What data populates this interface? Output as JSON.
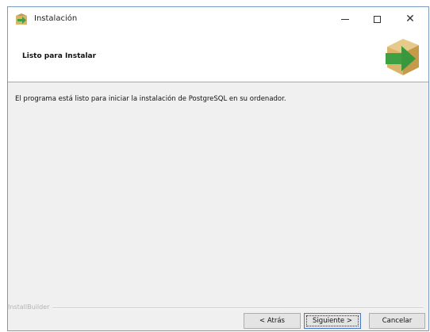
{
  "window": {
    "title": "Instalación",
    "controls": {
      "minimize": "minimize-icon",
      "maximize": "maximize-icon",
      "close": "close-icon"
    }
  },
  "header": {
    "title": "Listo para Instalar"
  },
  "body": {
    "message": "El programa está listo para iniciar la instalación de PostgreSQL en su ordenador."
  },
  "footer": {
    "brand": "InstallBuilder",
    "back_label": "< Atrás",
    "next_label": "Siguiente >",
    "cancel_label": "Cancelar"
  },
  "colors": {
    "box": "#d9b56a",
    "arrow": "#3fa043",
    "default_button_border": "#4b77c9"
  }
}
